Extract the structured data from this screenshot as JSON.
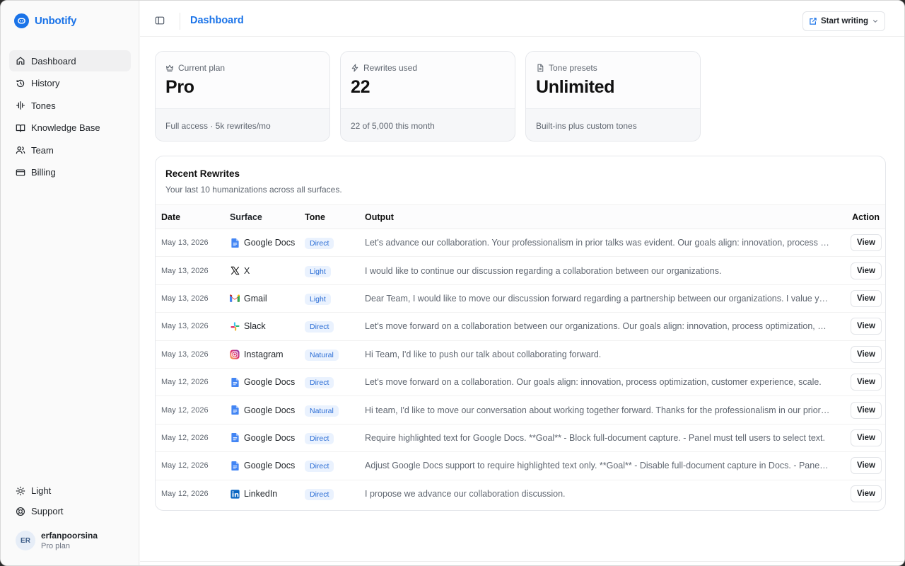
{
  "app": {
    "name": "Unbotify",
    "accent": "#1a73e8"
  },
  "sidebar": {
    "items": [
      {
        "label": "Dashboard",
        "icon": "home-icon",
        "active": true
      },
      {
        "label": "History",
        "icon": "history-icon"
      },
      {
        "label": "Tones",
        "icon": "waveform-icon"
      },
      {
        "label": "Knowledge Base",
        "icon": "book-icon"
      },
      {
        "label": "Team",
        "icon": "users-icon"
      },
      {
        "label": "Billing",
        "icon": "credit-card-icon"
      }
    ],
    "bottom": [
      {
        "label": "Light",
        "icon": "sun-icon"
      },
      {
        "label": "Support",
        "icon": "lifebuoy-icon"
      }
    ],
    "user": {
      "initials": "ER",
      "name": "erfanpoorsina",
      "plan": "Pro plan"
    }
  },
  "header": {
    "title": "Dashboard",
    "start_writing": "Start writing"
  },
  "cards": [
    {
      "label": "Current plan",
      "value": "Pro",
      "foot": "Full access · 5k rewrites/mo",
      "icon": "crown-icon"
    },
    {
      "label": "Rewrites used",
      "value": "22",
      "foot": "22 of 5,000 this month",
      "icon": "lightning-icon"
    },
    {
      "label": "Tone presets",
      "value": "Unlimited",
      "foot": "Built-ins plus custom tones",
      "icon": "document-icon"
    }
  ],
  "recent": {
    "title": "Recent Rewrites",
    "subtitle": "Your last 10 humanizations across all surfaces.",
    "columns": {
      "date": "Date",
      "surface": "Surface",
      "tone": "Tone",
      "output": "Output",
      "action": "Action"
    },
    "view_label": "View",
    "rows": [
      {
        "date": "May 13, 2026",
        "surface": "Google Docs",
        "icon": "google-docs-icon",
        "tone": "Direct",
        "output": "Let's advance our collaboration. Your professionalism in prior talks was evident. Our goals align: innovation, process optimization, and growth."
      },
      {
        "date": "May 13, 2026",
        "surface": "X",
        "icon": "x-logo-icon",
        "tone": "Light",
        "output": "I would like to continue our discussion regarding a collaboration between our organizations."
      },
      {
        "date": "May 13, 2026",
        "surface": "Gmail",
        "icon": "gmail-icon",
        "tone": "Light",
        "output": "Dear Team, I would like to move our discussion forward regarding a partnership between our organizations. I value your time."
      },
      {
        "date": "May 13, 2026",
        "surface": "Slack",
        "icon": "slack-icon",
        "tone": "Direct",
        "output": "Let's move forward on a collaboration between our organizations. Our goals align: innovation, process optimization, and more."
      },
      {
        "date": "May 13, 2026",
        "surface": "Instagram",
        "icon": "instagram-icon",
        "tone": "Natural",
        "output": "Hi Team, I'd like to push our talk about collaborating forward."
      },
      {
        "date": "May 12, 2026",
        "surface": "Google Docs",
        "icon": "google-docs-icon",
        "tone": "Direct",
        "output": "Let's move forward on a collaboration. Our goals align: innovation, process optimization, customer experience, scale."
      },
      {
        "date": "May 12, 2026",
        "surface": "Google Docs",
        "icon": "google-docs-icon",
        "tone": "Natural",
        "output": "Hi team, I'd like to move our conversation about working together forward. Thanks for the professionalism in our prior talks."
      },
      {
        "date": "May 12, 2026",
        "surface": "Google Docs",
        "icon": "google-docs-icon",
        "tone": "Direct",
        "output": "Require highlighted text for Google Docs. **Goal** - Block full-document capture. - Panel must tell users to select text."
      },
      {
        "date": "May 12, 2026",
        "surface": "Google Docs",
        "icon": "google-docs-icon",
        "tone": "Direct",
        "output": "Adjust Google Docs support to require highlighted text only. **Goal** - Disable full-document capture in Docs. - Panel update."
      },
      {
        "date": "May 12, 2026",
        "surface": "LinkedIn",
        "icon": "linkedin-icon",
        "tone": "Direct",
        "output": "I propose we advance our collaboration discussion."
      }
    ]
  }
}
